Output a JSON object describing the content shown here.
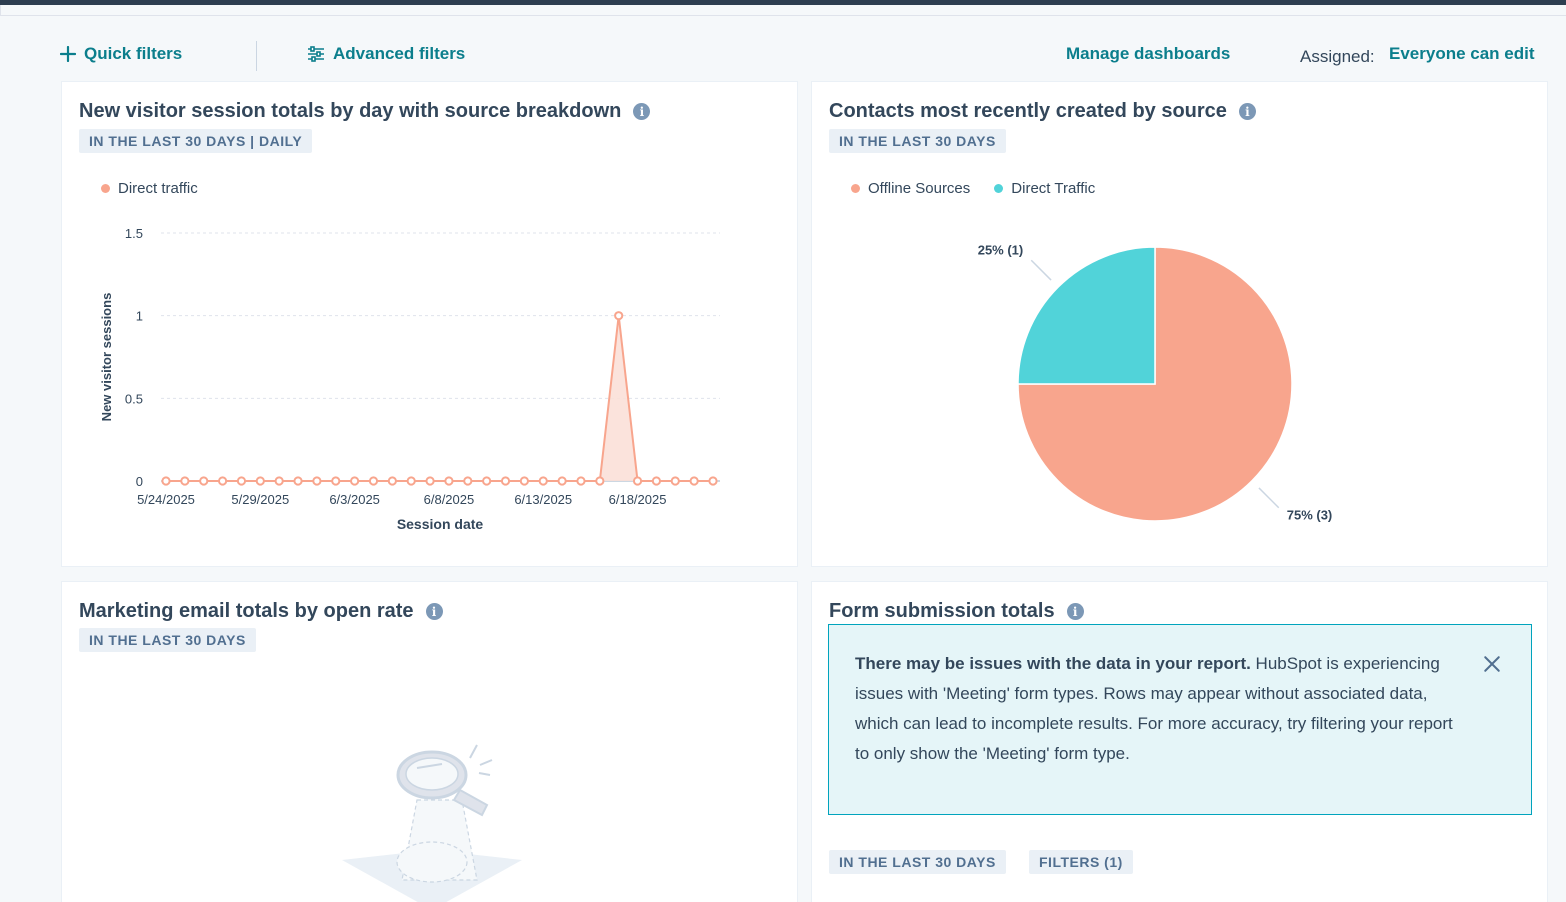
{
  "filters": {
    "quick_filters": "Quick filters",
    "advanced_filters": "Advanced filters",
    "manage_dashboards": "Manage dashboards",
    "assigned_label": "Assigned:",
    "assigned_value": "Everyone can edit"
  },
  "cards": {
    "sessions": {
      "title": "New visitor session totals by day with source breakdown",
      "tag": "IN THE LAST 30 DAYS | DAILY",
      "legend": "Direct traffic"
    },
    "contacts": {
      "title": "Contacts most recently created by source",
      "tag": "IN THE LAST 30 DAYS",
      "legend_offline": "Offline Sources",
      "legend_direct": "Direct Traffic"
    },
    "email": {
      "title": "Marketing email totals by open rate",
      "tag": "IN THE LAST 30 DAYS"
    },
    "forms": {
      "title": "Form submission totals",
      "alert_bold": "There may be issues with the data in your report.",
      "alert_text": " HubSpot is experiencing issues with 'Meeting' form types. Rows may appear without associated data, which can lead to incomplete results. For more accuracy, try filtering your report to only show the 'Meeting' form type.",
      "tag_range": "IN THE LAST 30 DAYS",
      "tag_filters": "FILTERS (1)"
    }
  },
  "colors": {
    "accent": "#0b7e8c",
    "salmon": "#f8a58d",
    "teal": "#51d3d9"
  },
  "chart_data": [
    {
      "type": "area",
      "xlabel": "Session date",
      "ylabel": "New visitor sessions",
      "ylim": [
        0,
        1.5
      ],
      "yticks": [
        "0",
        "0.5",
        "1",
        "1.5"
      ],
      "xticks": [
        "5/24/2025",
        "5/29/2025",
        "6/3/2025",
        "6/8/2025",
        "6/13/2025",
        "6/18/2025"
      ],
      "x": [
        "5/24/2025",
        "5/25/2025",
        "5/26/2025",
        "5/27/2025",
        "5/28/2025",
        "5/29/2025",
        "5/30/2025",
        "5/31/2025",
        "6/1/2025",
        "6/2/2025",
        "6/3/2025",
        "6/4/2025",
        "6/5/2025",
        "6/6/2025",
        "6/7/2025",
        "6/8/2025",
        "6/9/2025",
        "6/10/2025",
        "6/11/2025",
        "6/12/2025",
        "6/13/2025",
        "6/14/2025",
        "6/15/2025",
        "6/16/2025",
        "6/17/2025",
        "6/18/2025",
        "6/19/2025",
        "6/20/2025",
        "6/21/2025",
        "6/22/2025"
      ],
      "series": [
        {
          "name": "Direct traffic",
          "values": [
            0,
            0,
            0,
            0,
            0,
            0,
            0,
            0,
            0,
            0,
            0,
            0,
            0,
            0,
            0,
            0,
            0,
            0,
            0,
            0,
            0,
            0,
            0,
            0,
            1,
            0,
            0,
            0,
            0,
            0
          ]
        }
      ],
      "legend": "top-left",
      "grid": true
    },
    {
      "type": "pie",
      "categories": [
        "Offline Sources",
        "Direct Traffic"
      ],
      "values": [
        3,
        1
      ],
      "labels": [
        "75% (3)",
        "25% (1)"
      ]
    }
  ]
}
